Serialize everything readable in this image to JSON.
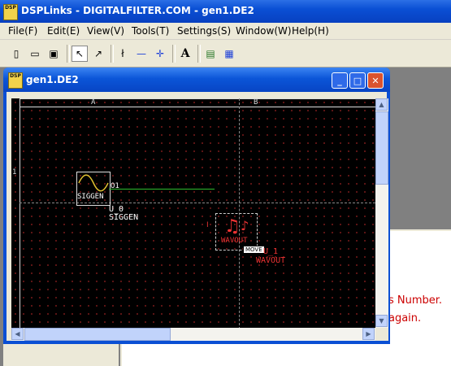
{
  "app": {
    "title": "DSPLinks - DIGITALFILTER.COM - gen1.DE2",
    "icon_text": "DSP"
  },
  "menu": {
    "items": [
      "File(F)",
      "Edit(E)",
      "View(V)",
      "Tools(T)",
      "Settings(S)",
      "Window(W)",
      "Help(H)"
    ]
  },
  "toolbar": {
    "buttons": [
      {
        "name": "new-file-icon",
        "glyph": "▯"
      },
      {
        "name": "open-folder-icon",
        "glyph": "▭"
      },
      {
        "name": "save-icon",
        "glyph": "▣"
      },
      {
        "name": "select-arrow-icon",
        "glyph": "↖"
      },
      {
        "name": "pointer-tool-icon",
        "glyph": "↗"
      },
      {
        "name": "text-align-icon",
        "glyph": "ł"
      },
      {
        "name": "horizontal-line-icon",
        "glyph": "—"
      },
      {
        "name": "cross-line-icon",
        "glyph": "✛"
      },
      {
        "name": "text-tool-icon",
        "glyph": "A"
      },
      {
        "name": "image-icon",
        "glyph": "▤"
      },
      {
        "name": "window-icon",
        "glyph": "▦"
      }
    ]
  },
  "child_window": {
    "title": "gen1.DE2",
    "icon_text": "DSP",
    "minimize": "_",
    "maximize": "□",
    "close": "✕"
  },
  "canvas": {
    "column_labels": [
      "A",
      "B"
    ],
    "row_labels": [
      "1"
    ],
    "siggen": {
      "label": "SIGGEN",
      "port": "O1",
      "instance": "U_0",
      "type": "SIGGEN"
    },
    "wavout": {
      "port": "I",
      "label": "WAVOUT",
      "move_badge": "MOVE",
      "instance": "U_1",
      "type": "WAVOUT"
    }
  },
  "background_window": {
    "text_line1": "s Number.",
    "text_line2": "again."
  },
  "colors": {
    "titlebar": "#0a4fd4",
    "canvas_bg": "#000000",
    "wire": "#2ebd2e",
    "wavout_red": "#e33333",
    "bg_text_red": "#cc0000"
  }
}
